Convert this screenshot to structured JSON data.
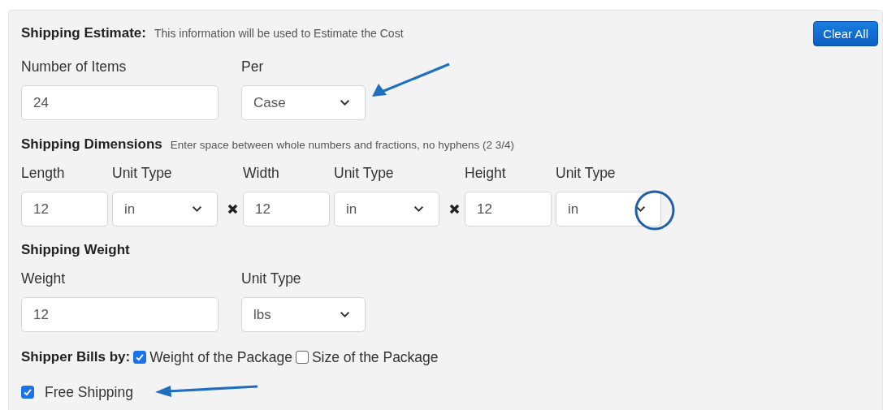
{
  "estimate": {
    "title": "Shipping Estimate:",
    "note": "This information will be used to Estimate the Cost",
    "button": "Clear All",
    "fields": [
      {
        "kind": "input",
        "label": "Number of Items",
        "value": "24"
      },
      {
        "kind": "select",
        "label": "Per",
        "value": "Case"
      }
    ]
  },
  "dimensions": {
    "title": "Shipping Dimensions",
    "note": "Enter space between whole numbers and fractions, no hyphens (2 3/4)",
    "groups": [
      {
        "fields": [
          {
            "kind": "input",
            "label": "Length",
            "value": "12"
          },
          {
            "kind": "select",
            "label": "Unit Type",
            "value": "in"
          }
        ]
      },
      {
        "fields": [
          {
            "kind": "input",
            "label": "Width",
            "value": "12"
          },
          {
            "kind": "select",
            "label": "Unit Type",
            "value": "in"
          }
        ]
      },
      {
        "fields": [
          {
            "kind": "input",
            "label": "Height",
            "value": "12"
          },
          {
            "kind": "select",
            "label": "Unit Type",
            "value": "in"
          }
        ]
      }
    ]
  },
  "weight": {
    "title": "Shipping Weight",
    "fields": [
      {
        "kind": "input",
        "label": "Weight",
        "value": "12"
      },
      {
        "kind": "select",
        "label": "Unit Type",
        "value": "lbs"
      }
    ]
  },
  "bills_by": {
    "label": "Shipper Bills by:",
    "options": [
      {
        "label": "Weight of the Package",
        "checked": true
      },
      {
        "label": "Size of the Package",
        "checked": false
      }
    ]
  },
  "free_shipping": {
    "label": "Free Shipping",
    "checked": true
  }
}
